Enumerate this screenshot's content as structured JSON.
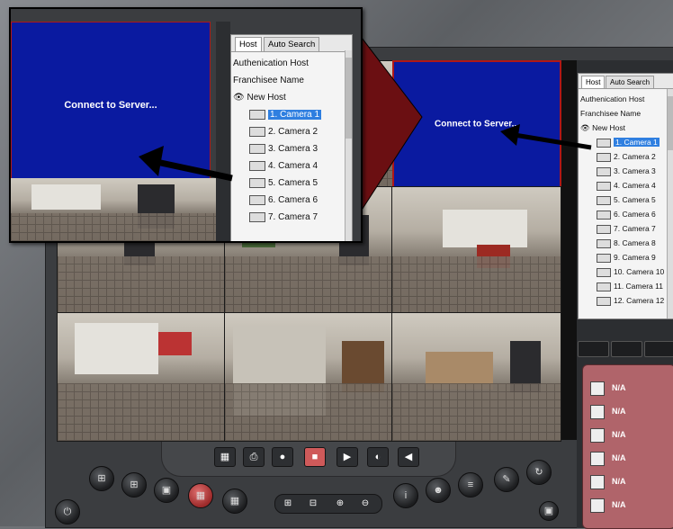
{
  "connect_text": "Connect to Server...",
  "tabs": [
    {
      "label": "Host"
    },
    {
      "label": "Auto Search"
    }
  ],
  "tree": {
    "auth_host": "Authenication Host",
    "franchisee": "Franchisee Name",
    "host": "New Host",
    "cameras_zoom": [
      "1. Camera 1",
      "2. Camera 2",
      "3. Camera 3",
      "4. Camera 4",
      "5. Camera 5",
      "6. Camera 6",
      "7. Camera 7"
    ],
    "cameras_main": [
      "1. Camera 1",
      "2. Camera 2",
      "3. Camera 3",
      "4. Camera 4",
      "5. Camera 5",
      "6. Camera 6",
      "7. Camera 7",
      "8. Camera 8",
      "9. Camera 9",
      "10. Camera 10",
      "11. Camera 11",
      "12. Camera 12"
    ]
  },
  "status": [
    "N/A",
    "N/A",
    "N/A",
    "N/A",
    "N/A",
    "N/A"
  ],
  "colors": {
    "video_loss": "#0a1aa0",
    "selection": "#2f7fe0",
    "status_panel": "#b0646a",
    "connector": "#6b0f12"
  }
}
